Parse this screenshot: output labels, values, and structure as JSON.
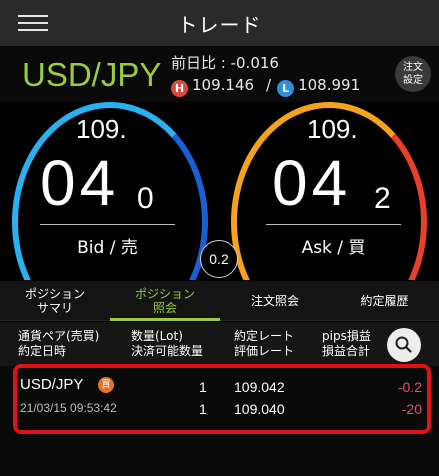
{
  "header": {
    "title": "トレード"
  },
  "summary": {
    "pair": "USD/JPY",
    "prev_day_change": "前日比 : -0.016",
    "high_badge": "H",
    "high": "109.146",
    "separator": "/",
    "low_badge": "L",
    "low": "108.991",
    "order_settings_line1": "注文",
    "order_settings_line2": "設定"
  },
  "bid": {
    "top": "109.",
    "big": "04",
    "small": "0",
    "label": "Bid / 売"
  },
  "ask": {
    "top": "109.",
    "big": "04",
    "small": "2",
    "label": "Ask / 買"
  },
  "spread": "0.2",
  "tabs": [
    {
      "line1": "ポジション",
      "line2": "サマリ"
    },
    {
      "line1": "ポジション",
      "line2": "照会"
    },
    {
      "line1": "注文照会",
      "line2": ""
    },
    {
      "line1": "約定履歴",
      "line2": ""
    }
  ],
  "columns": {
    "c1a": "通貨ペア(売買)",
    "c1b": "約定日時",
    "c2a": "数量(Lot)",
    "c2b": "決済可能数量",
    "c3a": "約定レート",
    "c3b": "評価レート",
    "c4a": "pips損益",
    "c4b": "損益合計"
  },
  "position": {
    "pair": "USD/JPY",
    "side": "買",
    "datetime": "21/03/15 09:53:42",
    "qty": "1",
    "settleable_qty": "1",
    "exec_rate": "109.042",
    "eval_rate": "109.040",
    "pips": "-0.2",
    "pnl": "-20"
  },
  "colors": {
    "accent": "#9ccc3c",
    "bid": "#1e9ae8",
    "ask": "#f08a1a",
    "loss": "#e8506a",
    "highlight": "#e01111"
  }
}
